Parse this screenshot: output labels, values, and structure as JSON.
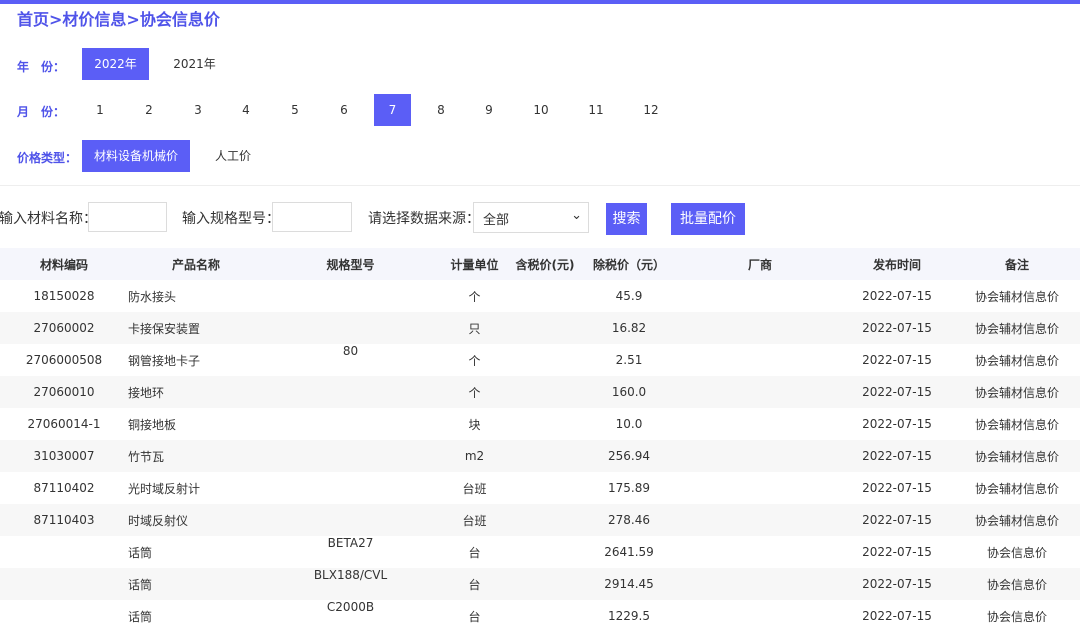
{
  "breadcrumb": "首页>材价信息>协会信息价",
  "filters": {
    "year": {
      "label": "年　份：",
      "options": [
        "2022年",
        "2021年"
      ],
      "selected": "2022年"
    },
    "month": {
      "label": "月　份：",
      "options": [
        "1",
        "2",
        "3",
        "4",
        "5",
        "6",
        "7",
        "8",
        "9",
        "10",
        "11",
        "12"
      ],
      "selected": "7"
    },
    "price_type": {
      "label": "价格类型：",
      "options": [
        "材料设备机械价",
        "人工价"
      ],
      "selected": "材料设备机械价"
    }
  },
  "search": {
    "material_name_label": "输入材料名称：",
    "material_name_value": "",
    "spec_label": "输入规格型号：",
    "spec_value": "",
    "source_label": "请选择数据来源：",
    "source_value": "全部",
    "search_button": "搜索",
    "batch_button": "批量配价"
  },
  "table": {
    "headers": [
      "材料编码",
      "产品名称",
      "规格型号",
      "计量单位",
      "含税价(元)",
      "除税价（元）",
      "厂商",
      "发布时间",
      "备注"
    ],
    "rows": [
      {
        "code": "18150028",
        "name": "防水接头",
        "spec": "",
        "unit": "个",
        "tax_price": "",
        "price": "45.9",
        "maker": "",
        "date": "2022-07-15",
        "remark": "协会辅材信息价"
      },
      {
        "code": "27060002",
        "name": "卡接保安装置",
        "spec": "",
        "unit": "只",
        "tax_price": "",
        "price": "16.82",
        "maker": "",
        "date": "2022-07-15",
        "remark": "协会辅材信息价"
      },
      {
        "code": "2706000508",
        "name": "钢管接地卡子",
        "spec": "80",
        "unit": "个",
        "tax_price": "",
        "price": "2.51",
        "maker": "",
        "date": "2022-07-15",
        "remark": "协会辅材信息价"
      },
      {
        "code": "27060010",
        "name": "接地环",
        "spec": "",
        "unit": "个",
        "tax_price": "",
        "price": "160.0",
        "maker": "",
        "date": "2022-07-15",
        "remark": "协会辅材信息价"
      },
      {
        "code": "27060014-1",
        "name": "铜接地板",
        "spec": "",
        "unit": "块",
        "tax_price": "",
        "price": "10.0",
        "maker": "",
        "date": "2022-07-15",
        "remark": "协会辅材信息价"
      },
      {
        "code": "31030007",
        "name": "竹节瓦",
        "spec": "",
        "unit": "m2",
        "tax_price": "",
        "price": "256.94",
        "maker": "",
        "date": "2022-07-15",
        "remark": "协会辅材信息价"
      },
      {
        "code": "87110402",
        "name": "光时域反射计",
        "spec": "",
        "unit": "台班",
        "tax_price": "",
        "price": "175.89",
        "maker": "",
        "date": "2022-07-15",
        "remark": "协会辅材信息价"
      },
      {
        "code": "87110403",
        "name": "时域反射仪",
        "spec": "",
        "unit": "台班",
        "tax_price": "",
        "price": "278.46",
        "maker": "",
        "date": "2022-07-15",
        "remark": "协会辅材信息价"
      },
      {
        "code": "",
        "name": "话筒",
        "spec": "BETA27",
        "unit": "台",
        "tax_price": "",
        "price": "2641.59",
        "maker": "",
        "date": "2022-07-15",
        "remark": "协会信息价"
      },
      {
        "code": "",
        "name": "话筒",
        "spec": "BLX188/CVL",
        "unit": "台",
        "tax_price": "",
        "price": "2914.45",
        "maker": "",
        "date": "2022-07-15",
        "remark": "协会信息价"
      },
      {
        "code": "",
        "name": "话筒",
        "spec": "C2000B",
        "unit": "台",
        "tax_price": "",
        "price": "1229.5",
        "maker": "",
        "date": "2022-07-15",
        "remark": "协会信息价"
      }
    ]
  },
  "colors": {
    "accent": "#5b5ef6",
    "label_blue": "#4f53e9",
    "header_bg": "#f5f6fc",
    "row_alt_bg": "#f7f7f7"
  }
}
